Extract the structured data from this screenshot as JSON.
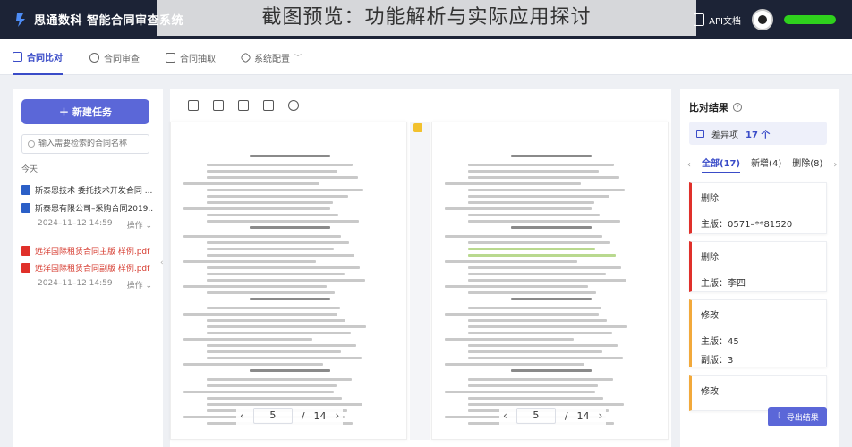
{
  "app": {
    "brand": "思通数科 智能合同审查系统",
    "watermark": "截图预览：功能解析与实际应用探讨"
  },
  "topbar": {
    "api_docs": "API文档"
  },
  "tabs": [
    {
      "label": "合同比对"
    },
    {
      "label": "合同审查"
    },
    {
      "label": "合同抽取"
    },
    {
      "label": "系统配置"
    }
  ],
  "left": {
    "new_task": "新建任务",
    "search_placeholder": "输入需要检索的合同名称",
    "today": "今天",
    "groups": [
      {
        "files": [
          "斯泰恩技术 委托技术开发合同 ...",
          "斯泰恩有限公司–采购合同2019..."
        ],
        "time": "2024–11–12 14:59",
        "action": "操作"
      },
      {
        "files": [
          "远洋国际租赁合同主版 样例.pdf",
          "远洋国际租赁合同副版 样例.pdf"
        ],
        "time": "2024–11–12 14:59",
        "action": "操作"
      }
    ]
  },
  "viewer": {
    "left_pager": {
      "page": "5",
      "sep": "/",
      "total": "14"
    },
    "right_pager": {
      "page": "5",
      "sep": "/",
      "total": "14"
    }
  },
  "right": {
    "title": "比对结果",
    "diff_label": "差异项",
    "diff_count": "17 个",
    "tabs": [
      "全部(17)",
      "新增(4)",
      "删除(8)"
    ],
    "cards": [
      {
        "kind": "删除",
        "lines": [
          "主版：0571–**81520"
        ]
      },
      {
        "kind": "删除",
        "lines": [
          "主版：李四"
        ]
      },
      {
        "kind": "修改",
        "lines": [
          "主版：45",
          "副版：3"
        ]
      },
      {
        "kind": "修改",
        "lines": []
      }
    ],
    "export": "导出结果"
  }
}
